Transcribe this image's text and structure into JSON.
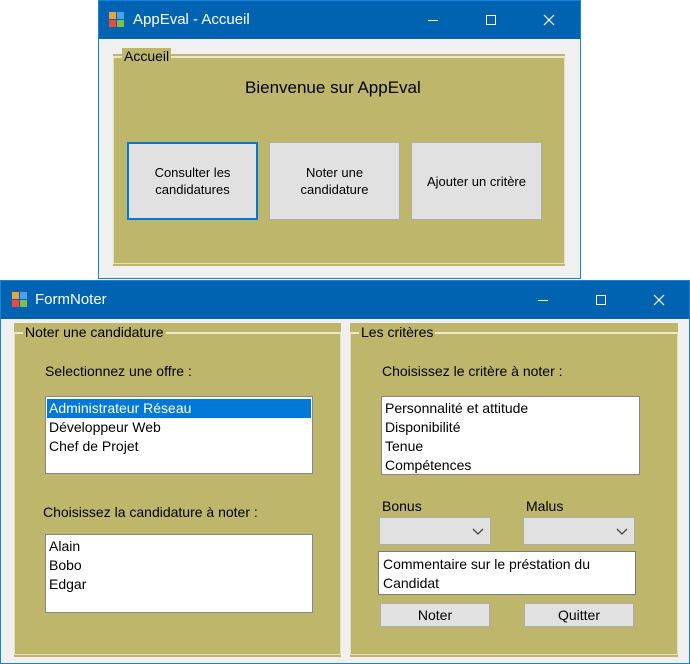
{
  "window_accueil": {
    "title": "AppEval - Accueil",
    "group_title": "Accueil",
    "welcome": "Bienvenue sur AppEval",
    "buttons": [
      {
        "label": "Consulter les candidatures"
      },
      {
        "label": "Noter une candidature"
      },
      {
        "label": "Ajouter un critère"
      }
    ]
  },
  "window_noter": {
    "title": "FormNoter",
    "left_group": {
      "title": "Noter une candidature",
      "offer_label": "Selectionnez une offre :",
      "offers": [
        "Administrateur Réseau",
        "Développeur Web",
        "Chef de Projet"
      ],
      "selected_offer": "Administrateur Réseau",
      "candidate_label": "Choisissez la candidature à noter :",
      "candidates": [
        "Alain",
        "Bobo",
        "Edgar"
      ]
    },
    "right_group": {
      "title": "Les critères",
      "criteria_label": "Choisissez le critère à noter :",
      "criteria": [
        "Personnalité et attitude",
        "Disponibilité",
        "Tenue",
        "Compétences"
      ],
      "bonus_label": "Bonus",
      "malus_label": "Malus",
      "bonus_value": "",
      "malus_value": "",
      "comment": "Commentaire sur le préstation du Candidat",
      "noter_button": "Noter",
      "quitter_button": "Quitter"
    }
  },
  "icons": {
    "minimize": "minimize-icon",
    "maximize": "maximize-icon",
    "close": "close-icon",
    "app": "app-icon",
    "dropdown": "chevron-down-icon"
  },
  "colors": {
    "titlebar": "#0063b1",
    "panel": "#bdb66b",
    "selection": "#0078d7",
    "focus_border": "#0078d7"
  }
}
